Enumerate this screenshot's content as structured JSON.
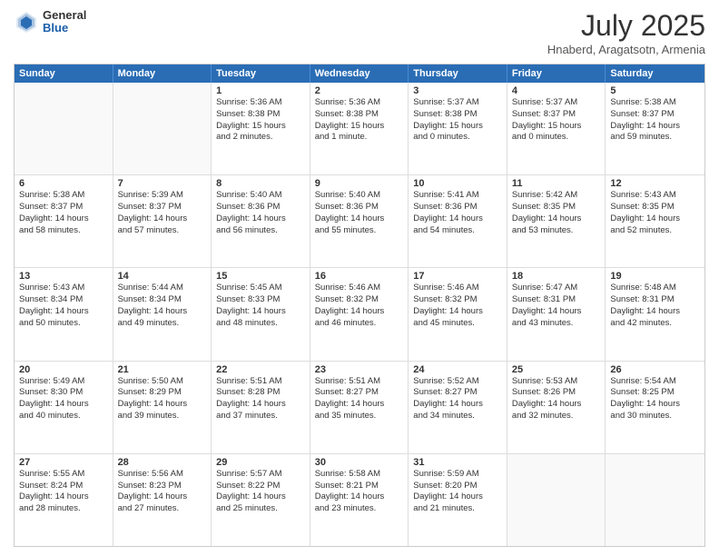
{
  "header": {
    "logo_general": "General",
    "logo_blue": "Blue",
    "month_title": "July 2025",
    "location": "Hnaberd, Aragatsotn, Armenia"
  },
  "weekdays": [
    "Sunday",
    "Monday",
    "Tuesday",
    "Wednesday",
    "Thursday",
    "Friday",
    "Saturday"
  ],
  "rows": [
    [
      {
        "day": "",
        "empty": true,
        "lines": []
      },
      {
        "day": "",
        "empty": true,
        "lines": []
      },
      {
        "day": "1",
        "lines": [
          "Sunrise: 5:36 AM",
          "Sunset: 8:38 PM",
          "Daylight: 15 hours",
          "and 2 minutes."
        ]
      },
      {
        "day": "2",
        "lines": [
          "Sunrise: 5:36 AM",
          "Sunset: 8:38 PM",
          "Daylight: 15 hours",
          "and 1 minute."
        ]
      },
      {
        "day": "3",
        "lines": [
          "Sunrise: 5:37 AM",
          "Sunset: 8:38 PM",
          "Daylight: 15 hours",
          "and 0 minutes."
        ]
      },
      {
        "day": "4",
        "lines": [
          "Sunrise: 5:37 AM",
          "Sunset: 8:37 PM",
          "Daylight: 15 hours",
          "and 0 minutes."
        ]
      },
      {
        "day": "5",
        "lines": [
          "Sunrise: 5:38 AM",
          "Sunset: 8:37 PM",
          "Daylight: 14 hours",
          "and 59 minutes."
        ]
      }
    ],
    [
      {
        "day": "6",
        "lines": [
          "Sunrise: 5:38 AM",
          "Sunset: 8:37 PM",
          "Daylight: 14 hours",
          "and 58 minutes."
        ]
      },
      {
        "day": "7",
        "lines": [
          "Sunrise: 5:39 AM",
          "Sunset: 8:37 PM",
          "Daylight: 14 hours",
          "and 57 minutes."
        ]
      },
      {
        "day": "8",
        "lines": [
          "Sunrise: 5:40 AM",
          "Sunset: 8:36 PM",
          "Daylight: 14 hours",
          "and 56 minutes."
        ]
      },
      {
        "day": "9",
        "lines": [
          "Sunrise: 5:40 AM",
          "Sunset: 8:36 PM",
          "Daylight: 14 hours",
          "and 55 minutes."
        ]
      },
      {
        "day": "10",
        "lines": [
          "Sunrise: 5:41 AM",
          "Sunset: 8:36 PM",
          "Daylight: 14 hours",
          "and 54 minutes."
        ]
      },
      {
        "day": "11",
        "lines": [
          "Sunrise: 5:42 AM",
          "Sunset: 8:35 PM",
          "Daylight: 14 hours",
          "and 53 minutes."
        ]
      },
      {
        "day": "12",
        "lines": [
          "Sunrise: 5:43 AM",
          "Sunset: 8:35 PM",
          "Daylight: 14 hours",
          "and 52 minutes."
        ]
      }
    ],
    [
      {
        "day": "13",
        "lines": [
          "Sunrise: 5:43 AM",
          "Sunset: 8:34 PM",
          "Daylight: 14 hours",
          "and 50 minutes."
        ]
      },
      {
        "day": "14",
        "lines": [
          "Sunrise: 5:44 AM",
          "Sunset: 8:34 PM",
          "Daylight: 14 hours",
          "and 49 minutes."
        ]
      },
      {
        "day": "15",
        "lines": [
          "Sunrise: 5:45 AM",
          "Sunset: 8:33 PM",
          "Daylight: 14 hours",
          "and 48 minutes."
        ]
      },
      {
        "day": "16",
        "lines": [
          "Sunrise: 5:46 AM",
          "Sunset: 8:32 PM",
          "Daylight: 14 hours",
          "and 46 minutes."
        ]
      },
      {
        "day": "17",
        "lines": [
          "Sunrise: 5:46 AM",
          "Sunset: 8:32 PM",
          "Daylight: 14 hours",
          "and 45 minutes."
        ]
      },
      {
        "day": "18",
        "lines": [
          "Sunrise: 5:47 AM",
          "Sunset: 8:31 PM",
          "Daylight: 14 hours",
          "and 43 minutes."
        ]
      },
      {
        "day": "19",
        "lines": [
          "Sunrise: 5:48 AM",
          "Sunset: 8:31 PM",
          "Daylight: 14 hours",
          "and 42 minutes."
        ]
      }
    ],
    [
      {
        "day": "20",
        "lines": [
          "Sunrise: 5:49 AM",
          "Sunset: 8:30 PM",
          "Daylight: 14 hours",
          "and 40 minutes."
        ]
      },
      {
        "day": "21",
        "lines": [
          "Sunrise: 5:50 AM",
          "Sunset: 8:29 PM",
          "Daylight: 14 hours",
          "and 39 minutes."
        ]
      },
      {
        "day": "22",
        "lines": [
          "Sunrise: 5:51 AM",
          "Sunset: 8:28 PM",
          "Daylight: 14 hours",
          "and 37 minutes."
        ]
      },
      {
        "day": "23",
        "lines": [
          "Sunrise: 5:51 AM",
          "Sunset: 8:27 PM",
          "Daylight: 14 hours",
          "and 35 minutes."
        ]
      },
      {
        "day": "24",
        "lines": [
          "Sunrise: 5:52 AM",
          "Sunset: 8:27 PM",
          "Daylight: 14 hours",
          "and 34 minutes."
        ]
      },
      {
        "day": "25",
        "lines": [
          "Sunrise: 5:53 AM",
          "Sunset: 8:26 PM",
          "Daylight: 14 hours",
          "and 32 minutes."
        ]
      },
      {
        "day": "26",
        "lines": [
          "Sunrise: 5:54 AM",
          "Sunset: 8:25 PM",
          "Daylight: 14 hours",
          "and 30 minutes."
        ]
      }
    ],
    [
      {
        "day": "27",
        "lines": [
          "Sunrise: 5:55 AM",
          "Sunset: 8:24 PM",
          "Daylight: 14 hours",
          "and 28 minutes."
        ]
      },
      {
        "day": "28",
        "lines": [
          "Sunrise: 5:56 AM",
          "Sunset: 8:23 PM",
          "Daylight: 14 hours",
          "and 27 minutes."
        ]
      },
      {
        "day": "29",
        "lines": [
          "Sunrise: 5:57 AM",
          "Sunset: 8:22 PM",
          "Daylight: 14 hours",
          "and 25 minutes."
        ]
      },
      {
        "day": "30",
        "lines": [
          "Sunrise: 5:58 AM",
          "Sunset: 8:21 PM",
          "Daylight: 14 hours",
          "and 23 minutes."
        ]
      },
      {
        "day": "31",
        "lines": [
          "Sunrise: 5:59 AM",
          "Sunset: 8:20 PM",
          "Daylight: 14 hours",
          "and 21 minutes."
        ]
      },
      {
        "day": "",
        "empty": true,
        "lines": []
      },
      {
        "day": "",
        "empty": true,
        "lines": []
      }
    ]
  ]
}
